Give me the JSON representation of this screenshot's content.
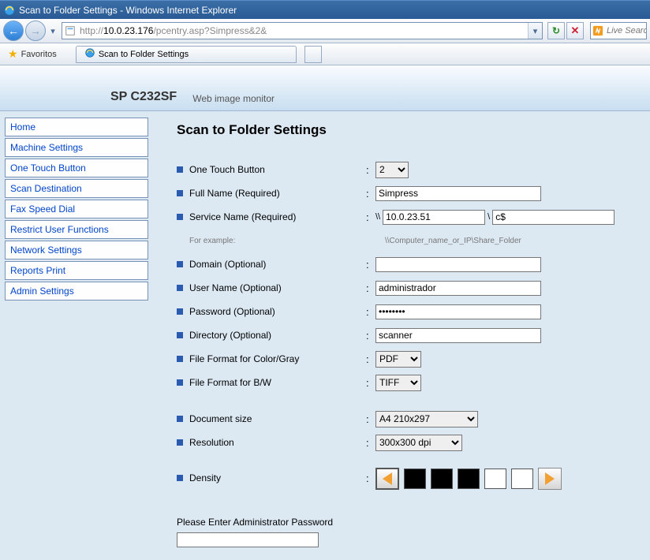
{
  "window": {
    "title": "Scan to Folder Settings - Windows Internet Explorer"
  },
  "addressbar": {
    "prefix": "http://",
    "host": "10.0.23.176",
    "path": "/pcentry.asp?Simpress&2&"
  },
  "search": {
    "placeholder": "Live Search"
  },
  "favorites": {
    "label": "Favoritos"
  },
  "tab": {
    "title": "Scan to Folder Settings"
  },
  "header": {
    "model": "SP C232SF",
    "subtitle": "Web image monitor"
  },
  "sidebar": {
    "items": [
      "Home",
      "Machine Settings",
      "One Touch Button",
      "Scan Destination",
      "Fax Speed Dial",
      "Restrict User Functions",
      "Network Settings",
      "Reports Print",
      "Admin Settings"
    ]
  },
  "page": {
    "title": "Scan to Folder Settings",
    "onetouch_label": "One Touch Button",
    "onetouch_value": "2",
    "fullname_label": "Full Name (Required)",
    "fullname_value": "Simpress",
    "servicename_label": "Service Name (Required)",
    "service_prefix": "\\\\",
    "service_host": "10.0.23.51",
    "service_sep": "\\",
    "service_share": "c$",
    "example_label": "For example:",
    "example_hint": "\\\\Computer_name_or_IP\\Share_Folder",
    "domain_label": "Domain (Optional)",
    "domain_value": "",
    "username_label": "User Name (Optional)",
    "username_value": "administrador",
    "password_label": "Password (Optional)",
    "password_value": "password",
    "directory_label": "Directory (Optional)",
    "directory_value": "scanner",
    "ff_color_label": "File Format for Color/Gray",
    "ff_color_value": "PDF",
    "ff_bw_label": "File Format for B/W",
    "ff_bw_value": "TIFF",
    "docsize_label": "Document size",
    "docsize_value": "A4 210x297",
    "resolution_label": "Resolution",
    "resolution_value": "300x300 dpi",
    "density_label": "Density",
    "admin_prompt": "Please Enter Administrator Password"
  }
}
